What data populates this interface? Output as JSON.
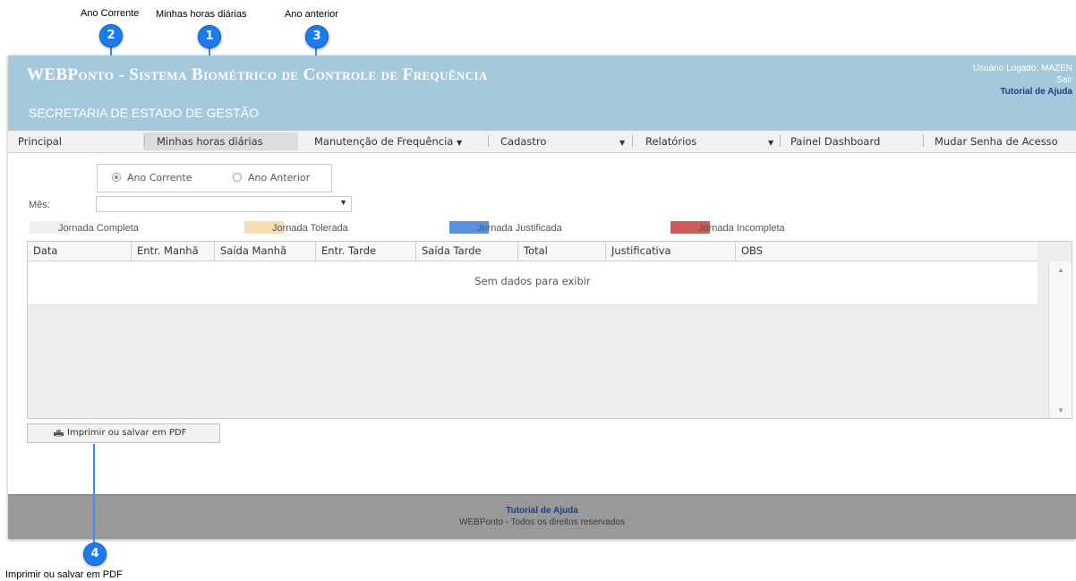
{
  "annotations": {
    "c1": {
      "label": "Minhas horas diárias",
      "number": "1"
    },
    "c2": {
      "label": "Ano Corrente",
      "number": "2"
    },
    "c3": {
      "label": "Ano anterior",
      "number": "3"
    },
    "c4": {
      "label": "Imprimir ou salvar em PDF",
      "number": "4"
    }
  },
  "header": {
    "title": "WEBPonto - Sistema Biométrico de Controle de Frequência",
    "subtitle": "SECRETARIA DE ESTADO DE GESTÃO",
    "user": "Usuário Logado: MAZEN",
    "logout": "Sair",
    "help": "Tutorial de Ajuda",
    "background_color": "#a4c9dc"
  },
  "menu": {
    "principal": "Principal",
    "horas": "Minhas horas diárias",
    "manutencao": "Manutenção de Frequência",
    "cadastro": "Cadastro",
    "relatorios": "Relatórios",
    "painel": "Painel Dashboard",
    "senha": "Mudar Senha de Acesso",
    "caret_icon": "chevron-down-icon"
  },
  "filters": {
    "radio_current": "Ano Corrente",
    "radio_previous": "Ano Anterior",
    "selected": "Ano Corrente",
    "mes_label": "Mês:",
    "mes_value": ""
  },
  "legend": [
    {
      "label": "Jornada Completa",
      "color": "#f0f0f0"
    },
    {
      "label": "Jornada Tolerada",
      "color": "#f6ddb3"
    },
    {
      "label": "Jornada Justificada",
      "color": "#5b8fe0"
    },
    {
      "label": "Jornada Incompleta",
      "color": "#cf5a5a"
    }
  ],
  "table": {
    "columns": [
      "Data",
      "Entr. Manhã",
      "Saída Manhã",
      "Entr. Tarde",
      "Saída Tarde",
      "Total",
      "Justificativa",
      "OBS"
    ],
    "empty_message": "Sem dados para exibir"
  },
  "print_button": {
    "label": "Imprimir ou salvar em PDF",
    "icon": "printer-icon"
  },
  "footer": {
    "link": "Tutorial de Ajuda",
    "copyright": "WEBPonto - Todos os direitos reservados"
  }
}
